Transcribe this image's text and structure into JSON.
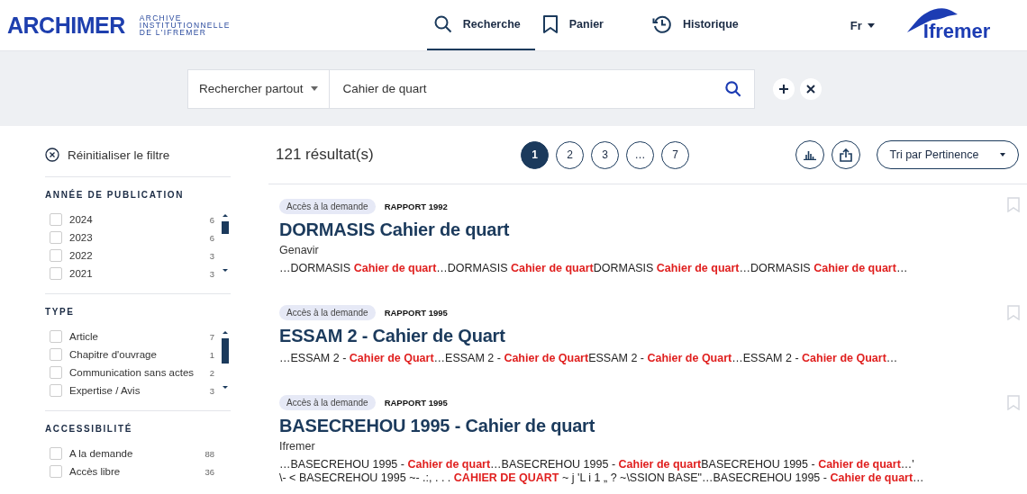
{
  "header": {
    "logo": "ARCHIMER",
    "tagline_lines": [
      "ARCHIVE",
      "INSTITUTIONNELLE",
      "DE L'IFREMER"
    ],
    "nav": [
      {
        "label": "Recherche",
        "selected": true
      },
      {
        "label": "Panier",
        "selected": false
      },
      {
        "label": "Historique",
        "selected": false
      }
    ],
    "language": "Fr",
    "partner_logo": "Ifremer"
  },
  "search": {
    "scope": "Rechercher partout",
    "value": "Cahier de quart"
  },
  "reset_filter": "Réinitialiser le filtre",
  "filters": [
    {
      "title": "ANNÉE DE PUBLICATION",
      "scroll": true,
      "options": [
        {
          "label": "2024",
          "count": "6",
          "checked": false
        },
        {
          "label": "2023",
          "count": "6",
          "checked": false
        },
        {
          "label": "2022",
          "count": "3",
          "checked": false
        },
        {
          "label": "2021",
          "count": "3",
          "checked": false
        }
      ]
    },
    {
      "title": "TYPE",
      "scroll": true,
      "options": [
        {
          "label": "Article",
          "count": "7",
          "checked": false
        },
        {
          "label": "Chapitre d'ouvrage",
          "count": "1",
          "checked": false
        },
        {
          "label": "Communication sans actes",
          "count": "2",
          "checked": false
        },
        {
          "label": "Expertise / Avis",
          "count": "3",
          "checked": false
        }
      ]
    },
    {
      "title": "ACCESSIBILITÉ",
      "scroll": false,
      "options": [
        {
          "label": "A la demande",
          "count": "88",
          "checked": false
        },
        {
          "label": "Accès libre",
          "count": "36",
          "checked": false
        }
      ]
    }
  ],
  "results_count": "121 résultat(s)",
  "pages": [
    {
      "label": "1",
      "selected": true
    },
    {
      "label": "2",
      "selected": false
    },
    {
      "label": "3",
      "selected": false
    },
    {
      "label": "…",
      "selected": false
    },
    {
      "label": "7",
      "selected": false
    }
  ],
  "sort": "Tri par Pertinence",
  "results": [
    {
      "access": "Accès à la demande",
      "type": "RAPPORT 1992",
      "title": "DORMASIS Cahier de quart",
      "author": "Genavir",
      "snippet_lines": [
        "…DORMASIS **Cahier de quart**…DORMASIS **Cahier de quart**DORMASIS **Cahier de quart**…DORMASIS **Cahier de quart**…"
      ]
    },
    {
      "access": "Accès à la demande",
      "type": "RAPPORT 1995",
      "title": "ESSAM 2 - Cahier de Quart",
      "snippet_lines": [
        "…ESSAM 2 - **Cahier de Quart**…ESSAM 2 - **Cahier de Quart**ESSAM 2 - **Cahier de Quart**…ESSAM 2 - **Cahier de Quart**…"
      ]
    },
    {
      "access": "Accès à la demande",
      "type": "RAPPORT 1995",
      "title": "BASECREHOU 1995 - Cahier de quart",
      "author": "Ifremer",
      "snippet_lines": [
        "…BASECREHOU 1995 - **Cahier de quart**…BASECREHOU 1995 - **Cahier de quart**BASECREHOU 1995 - **Cahier de quart**…'",
        "\\- < BASECREHOU 1995 ~- .:, . . . **CAHIER DE QUART** ~ j 'L i 1 „ ? ~\\SSION BASE\"…BASECREHOU 1995 - **Cahier de quart**…"
      ]
    }
  ]
}
